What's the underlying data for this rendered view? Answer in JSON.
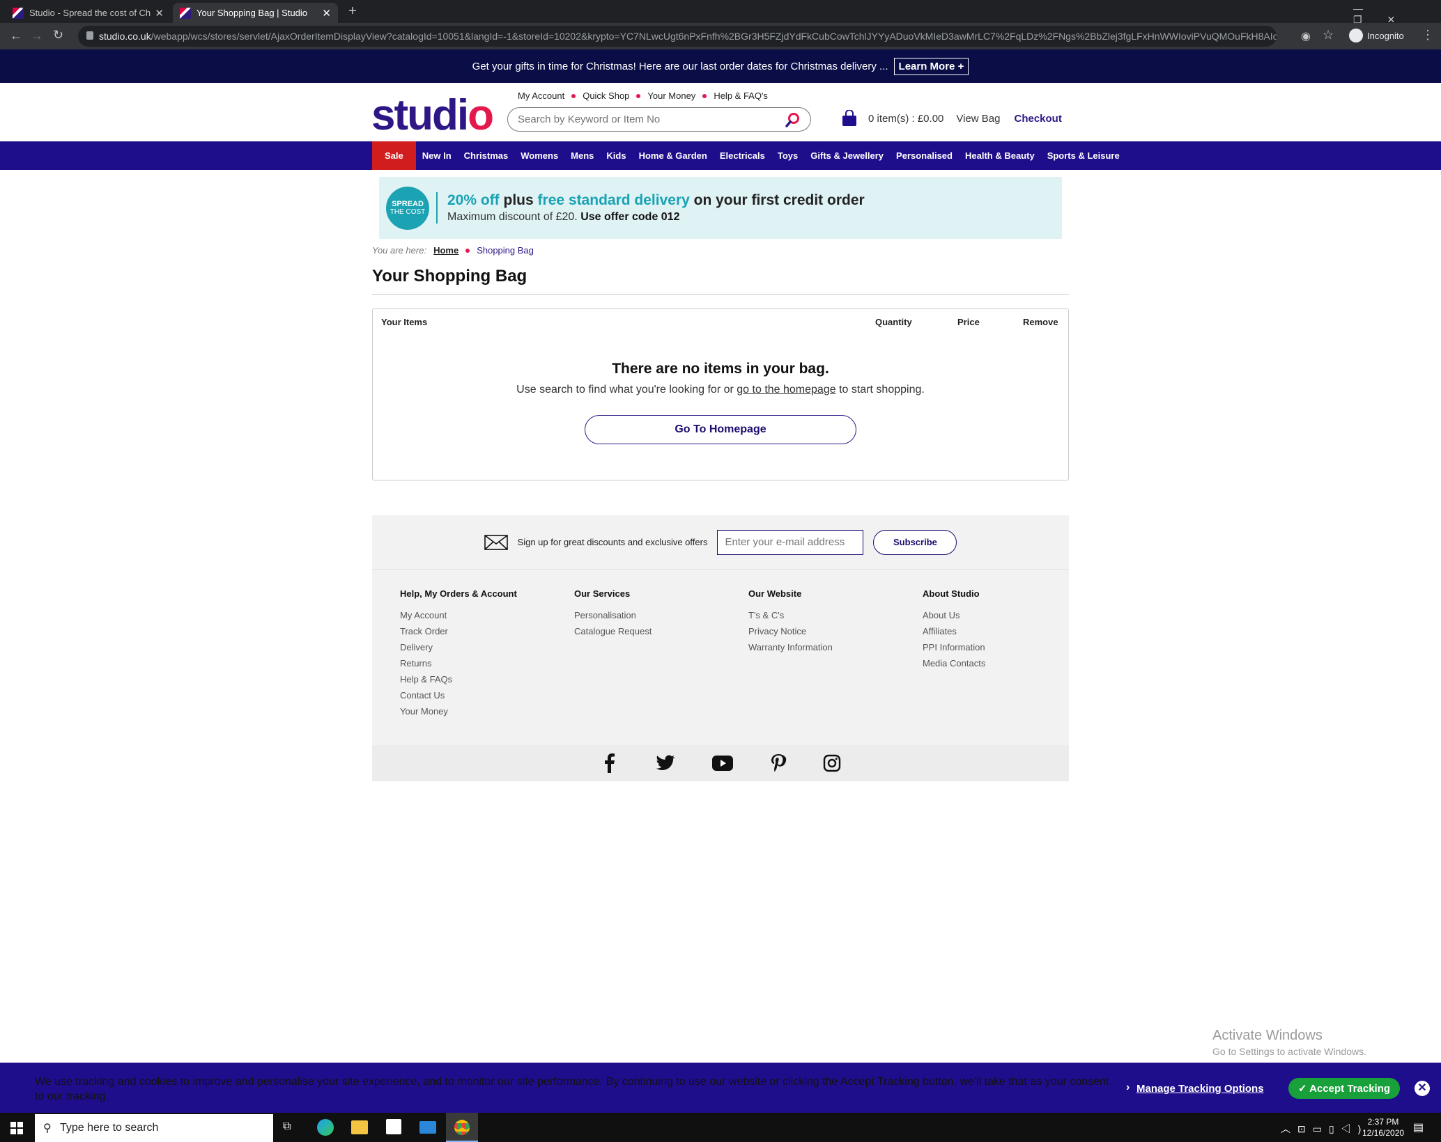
{
  "browser": {
    "tabs": [
      {
        "title": "Studio - Spread the cost of Chris"
      },
      {
        "title": "Your Shopping Bag | Studio"
      }
    ],
    "url_host": "studio.co.uk",
    "url_path": "/webapp/wcs/stores/servlet/AjaxOrderItemDisplayView?catalogId=10051&langId=-1&storeId=10202&krypto=YC7NLwcUgt6nPxFnfh%2BGr3H5FZjdYdFkCubCowTchlJYYyADuoVkMIeD3awMrLC7%2FqLDz%2FNgs%2BbZlej3fgLFxHnWWIoviPVuQMOuFkH8AIcCfUJYi...",
    "profile_label": "Incognito"
  },
  "promo": {
    "text": "Get your gifts in time for Christmas! Here are our last order dates for Christmas delivery ...",
    "link": "Learn More +"
  },
  "header": {
    "logo_main": "studi",
    "logo_o": "o",
    "top_links": [
      "My Account",
      "Quick Shop",
      "Your Money",
      "Help & FAQ's"
    ],
    "search_placeholder": "Search by Keyword or Item No",
    "bag_summary": "0 item(s) : £0.00",
    "view_bag": "View Bag",
    "checkout": "Checkout"
  },
  "nav": [
    "Sale",
    "New In",
    "Christmas",
    "Womens",
    "Mens",
    "Kids",
    "Home & Garden",
    "Electricals",
    "Toys",
    "Gifts & Jewellery",
    "Personalised",
    "Health & Beauty",
    "Sports & Leisure"
  ],
  "banner": {
    "badge_top": "SPREAD",
    "badge_bottom": "THE COST",
    "pct": "20% off",
    "plus": " plus ",
    "delivery": "free standard delivery",
    "rest": " on your first credit order",
    "line2": "Maximum discount of £20.",
    "code": " Use offer code 012"
  },
  "breadcrumb": {
    "label": "You are here:",
    "home": "Home",
    "current": "Shopping Bag"
  },
  "page_title": "Your Shopping Bag",
  "bag": {
    "col_items": "Your Items",
    "col_quantity": "Quantity",
    "col_price": "Price",
    "col_remove": "Remove",
    "empty_title": "There are no items in your bag.",
    "empty_pre": "Use search to find what you're looking for or ",
    "empty_link": "go to the homepage",
    "empty_post": " to start shopping.",
    "button": "Go To Homepage"
  },
  "footer": {
    "signup_text": "Sign up for great discounts and exclusive offers",
    "email_placeholder": "Enter your e-mail address",
    "subscribe": "Subscribe",
    "columns": [
      {
        "heading": "Help, My Orders & Account",
        "links": [
          "My Account",
          "Track Order",
          "Delivery",
          "Returns",
          "Help & FAQs",
          "Contact Us",
          "Your Money"
        ]
      },
      {
        "heading": "Our Services",
        "links": [
          "Personalisation",
          "Catalogue Request"
        ]
      },
      {
        "heading": "Our Website",
        "links": [
          "T's & C's",
          "Privacy Notice",
          "Warranty Information"
        ]
      },
      {
        "heading": "About Studio",
        "links": [
          "About Us",
          "Affiliates",
          "PPI Information",
          "Media Contacts"
        ]
      }
    ],
    "social_icons": [
      "facebook-icon",
      "twitter-icon",
      "youtube-icon",
      "pinterest-icon",
      "instagram-icon"
    ]
  },
  "watermark": {
    "line1": "Activate Windows",
    "line2": "Go to Settings to activate Windows."
  },
  "cookie": {
    "text": "We use tracking and cookies to improve and personalise your site experience, and to monitor our site performance. By continuing to use our website or clicking the Accept Tracking button, we'll take that as your consent to our tracking.",
    "manage": "Manage Tracking Options",
    "accept": "✓ Accept Tracking"
  },
  "taskbar": {
    "search_placeholder": "Type here to search",
    "time": "2:37 PM",
    "date": "12/16/2020"
  },
  "colors": {
    "brand_purple": "#1f0e8c",
    "brand_pink": "#e5184d",
    "teal": "#18a2b4",
    "sale_red": "#d11d1d",
    "accept_green": "#18a13a"
  }
}
